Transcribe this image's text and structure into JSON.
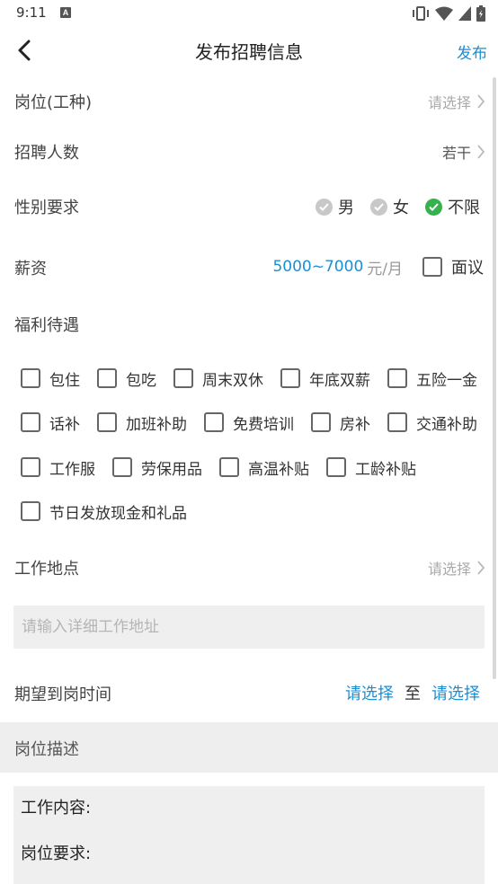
{
  "status": {
    "time": "9:11",
    "notif_letter": "A"
  },
  "nav": {
    "title": "发布招聘信息",
    "publish": "发布"
  },
  "position": {
    "label": "岗位(工种)",
    "value": "请选择"
  },
  "headcount": {
    "label": "招聘人数",
    "value": "若干"
  },
  "gender": {
    "label": "性别要求",
    "options": [
      {
        "label": "男",
        "selected": false
      },
      {
        "label": "女",
        "selected": false
      },
      {
        "label": "不限",
        "selected": true
      }
    ]
  },
  "salary": {
    "label": "薪资",
    "value": "5000~7000",
    "unit": "元/月",
    "negotiable_label": "面议",
    "negotiable": false
  },
  "benefits": {
    "label": "福利待遇",
    "rows": [
      [
        "包住",
        "包吃",
        "周末双休",
        "年底双薪",
        "五险一金"
      ],
      [
        "话补",
        "加班补助",
        "免费培训",
        "房补",
        "交通补助"
      ],
      [
        "工作服",
        "劳保用品",
        "高温补贴",
        "工龄补贴"
      ],
      [
        "节日发放现金和礼品"
      ]
    ]
  },
  "location": {
    "label": "工作地点",
    "value": "请选择",
    "address_placeholder": "请输入详细工作地址"
  },
  "arrival": {
    "label": "期望到岗时间",
    "from": "请选择",
    "to_word": "至",
    "to": "请选择"
  },
  "description": {
    "section_title": "岗位描述",
    "content_label": "工作内容:",
    "requirement_label": "岗位要求:"
  },
  "colors": {
    "accent": "#1a8fd6",
    "selected": "#35b24b",
    "unselected": "#c8c8c8"
  }
}
